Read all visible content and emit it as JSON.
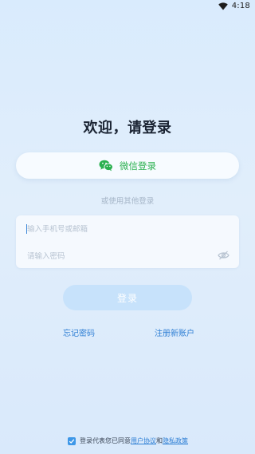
{
  "status_bar": {
    "time": "4:18",
    "wifi_icon": "wifi-icon"
  },
  "header": {
    "title": "欢迎，请登录"
  },
  "wechat_login": {
    "icon": "wechat-icon",
    "label": "微信登录",
    "color": "#2ab04f"
  },
  "other_login_hint": "或使用其他登录",
  "form": {
    "phone_placeholder": "输入手机号或邮箱",
    "phone_value": "",
    "password_placeholder": "请输入密码",
    "password_value": "",
    "password_toggle_icon": "eye-off-icon"
  },
  "login_button": {
    "label": "登录"
  },
  "links": {
    "forgot_password": "忘记密码",
    "register": "注册新账户"
  },
  "agreement": {
    "checked": true,
    "prefix": "登录代表您已同意",
    "user_agreement": "用户协议",
    "conjunction": "和",
    "privacy_policy": "隐私政策"
  },
  "colors": {
    "accent": "#2d7ed4",
    "button_disabled": "#c7e2fb",
    "wechat_green": "#2ab04f"
  }
}
